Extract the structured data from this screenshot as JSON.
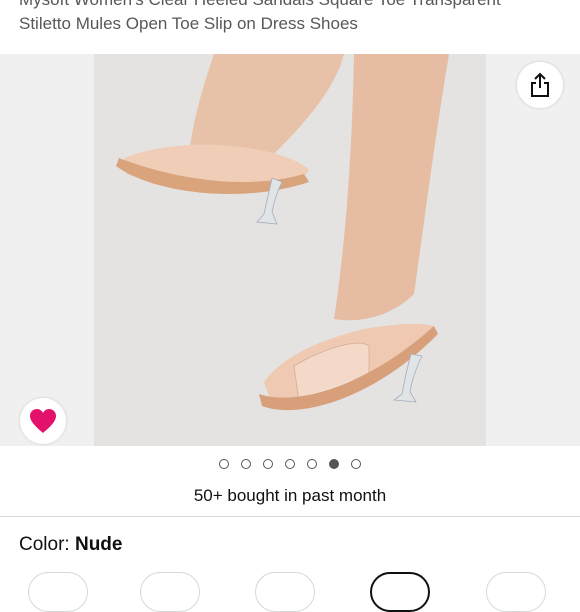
{
  "product": {
    "title_line1": "Mysoft Women's Clear Heeled Sandals Square Toe Transparent",
    "title_line2": "Stiletto Mules Open Toe Slip on Dress Shoes"
  },
  "gallery": {
    "share_icon": "share-icon",
    "favorite_icon": "heart-icon",
    "favorite_color": "#e3116c",
    "image_count": 7,
    "active_index": 6
  },
  "social_proof": {
    "bought_text": "50+ bought in past month"
  },
  "variation": {
    "color_label": "Color: ",
    "color_value": "Nude"
  }
}
